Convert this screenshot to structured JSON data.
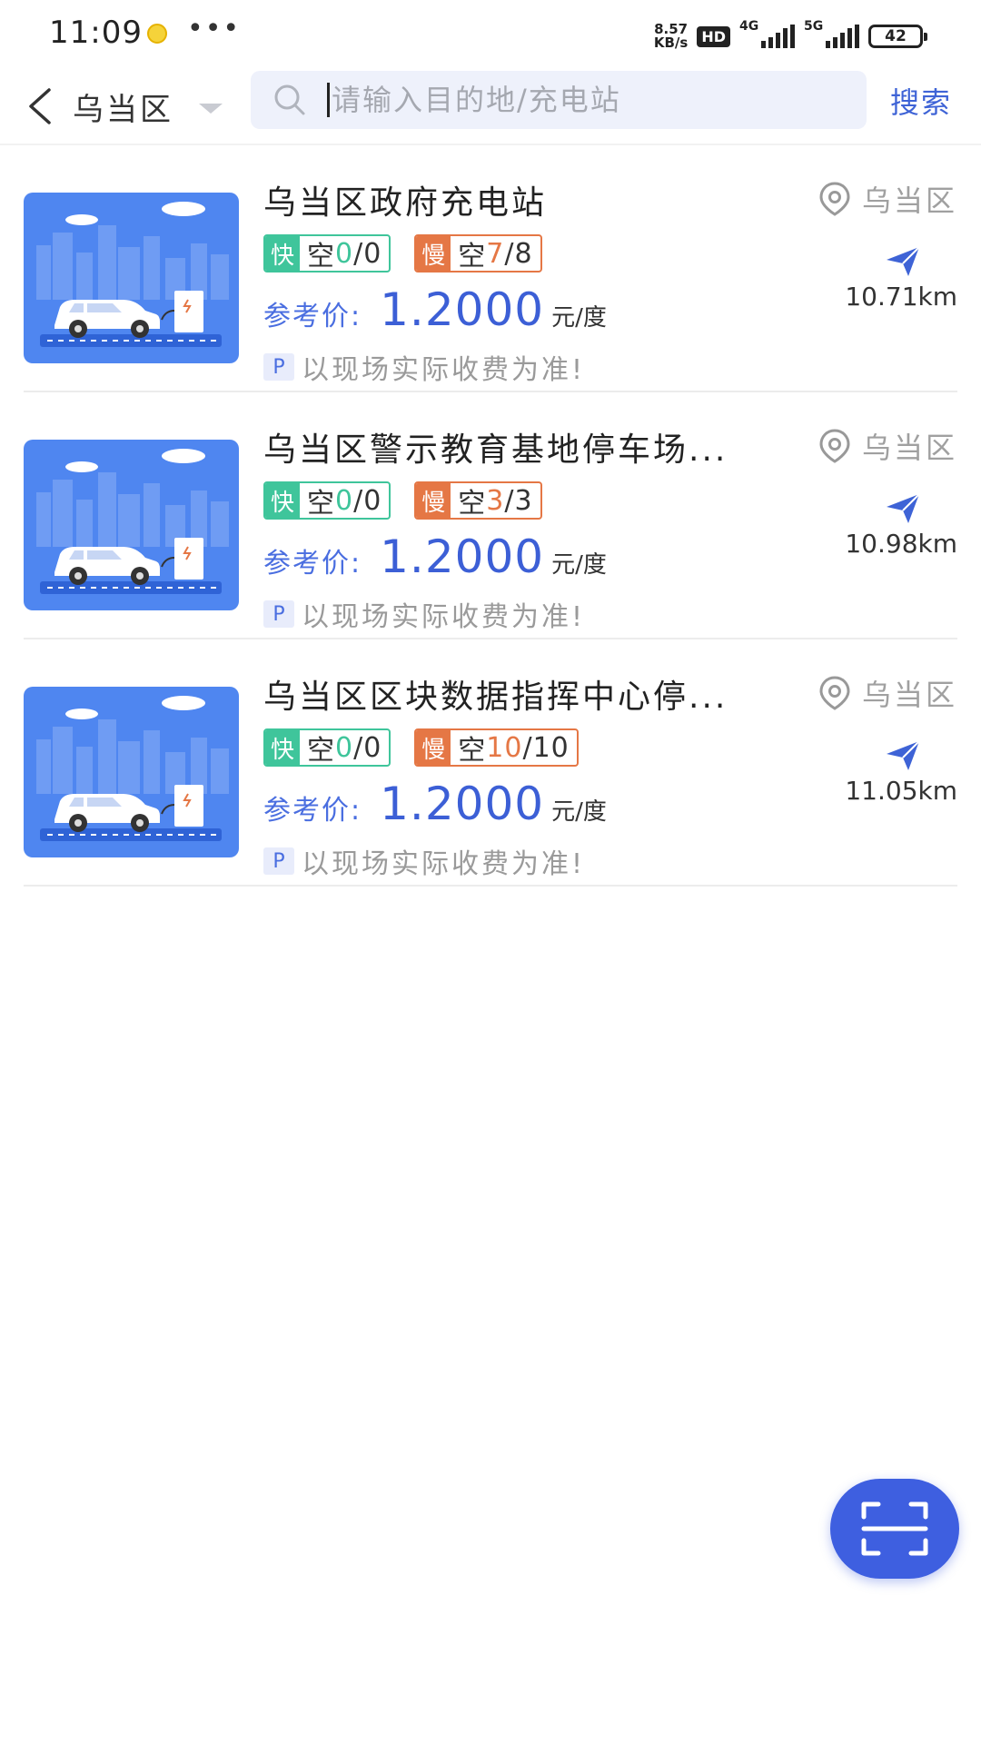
{
  "status": {
    "time": "11:09",
    "dots": "•••",
    "net_speed_value": "8.57",
    "net_speed_unit": "KB/s",
    "hd": "HD",
    "signal_1": "4G",
    "signal_2": "5G",
    "battery": "42"
  },
  "header": {
    "region": "乌当区",
    "search_placeholder": "请输入目的地/充电站",
    "search_button": "搜索"
  },
  "labels": {
    "fast": "快",
    "slow": "慢",
    "free_prefix": "空",
    "price_label": "参考价:",
    "price_unit": "元/度",
    "parking_badge": "P",
    "note": "以现场实际收费为准!"
  },
  "stations": [
    {
      "name": "乌当区政府充电站",
      "district": "乌当区",
      "fast_free": "0",
      "fast_total": "/0",
      "slow_free": "7",
      "slow_total": "/8",
      "price": "1.2000",
      "distance": "10.71km"
    },
    {
      "name": "乌当区警示教育基地停车场...",
      "district": "乌当区",
      "fast_free": "0",
      "fast_total": "/0",
      "slow_free": "3",
      "slow_total": "/3",
      "price": "1.2000",
      "distance": "10.98km"
    },
    {
      "name": "乌当区区块数据指挥中心停...",
      "district": "乌当区",
      "fast_free": "0",
      "fast_total": "/0",
      "slow_free": "10",
      "slow_total": "/10",
      "price": "1.2000",
      "distance": "11.05km"
    }
  ],
  "icons": {
    "back": "chevron-left-icon",
    "search": "search-icon",
    "location": "location-pin-icon",
    "navigate": "paper-plane-icon",
    "scan": "scan-icon"
  },
  "colors": {
    "accent": "#3e5fe0",
    "fast": "#3fc59b",
    "slow": "#e57745",
    "search_bg": "#eef1fb"
  }
}
